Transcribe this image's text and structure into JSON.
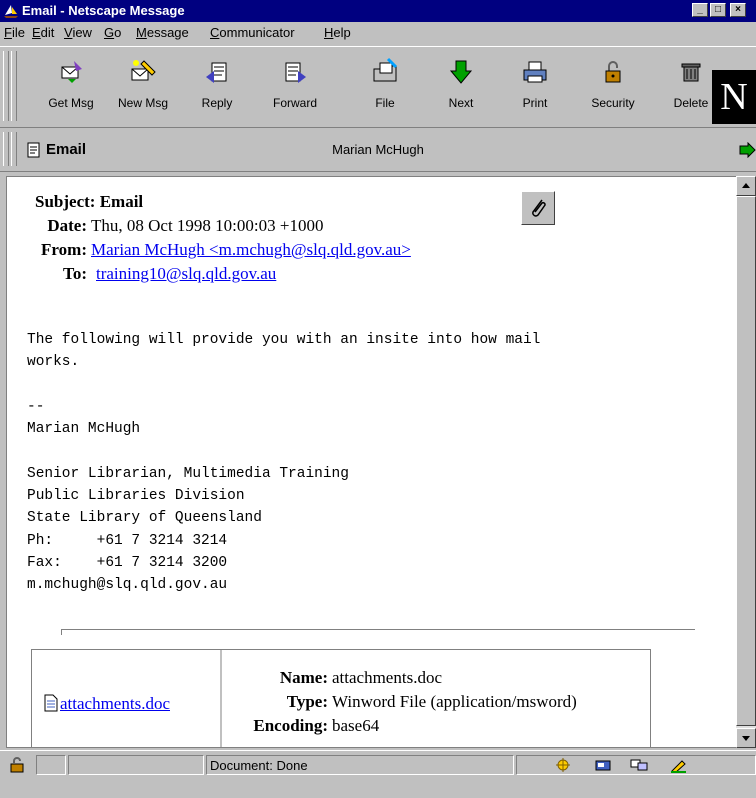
{
  "window": {
    "title": "Email - Netscape Message"
  },
  "menu": [
    {
      "label": "File",
      "underline": "F",
      "rest": "ile"
    },
    {
      "label": "Edit",
      "underline": "E",
      "rest": "dit"
    },
    {
      "label": "View",
      "underline": "V",
      "rest": "iew"
    },
    {
      "label": "Go",
      "underline": "G",
      "rest": "o"
    },
    {
      "label": "Message",
      "underline": "M",
      "rest": "essage"
    },
    {
      "label": "Communicator",
      "underline": "C",
      "rest": "ommunicator"
    },
    {
      "label": "Help",
      "underline": "H",
      "rest": "elp"
    }
  ],
  "toolbar": {
    "get_msg": "Get Msg",
    "new_msg": "New Msg",
    "reply": "Reply",
    "forward": "Forward",
    "file": "File",
    "next": "Next",
    "print": "Print",
    "security": "Security",
    "delete": "Delete",
    "logo": "N"
  },
  "location": {
    "title": "Email",
    "sender": "Marian McHugh"
  },
  "message": {
    "subject_label": "Subject:",
    "subject": "Email",
    "date_label": "Date:",
    "date": "Thu, 08 Oct 1998 10:00:03 +1000",
    "from_label": "From:",
    "from": "Marian McHugh <m.mchugh@slq.qld.gov.au>",
    "to_label": "To:",
    "to": "training10@slq.qld.gov.au",
    "body": "The following will provide you with an insite into how mail\nworks.\n\n--\nMarian McHugh\n\nSenior Librarian, Multimedia Training\nPublic Libraries Division\nState Library of Queensland\nPh:     +61 7 3214 3214\nFax:    +61 7 3214 3200\nm.mchugh@slq.qld.gov.au"
  },
  "attachment": {
    "filename": "attachments.doc",
    "name_label": "Name:",
    "name": "attachments.doc",
    "type_label": "Type:",
    "type": "Winword File (application/msword)",
    "encoding_label": "Encoding:",
    "encoding": "base64"
  },
  "status": {
    "text": "Document: Done"
  }
}
